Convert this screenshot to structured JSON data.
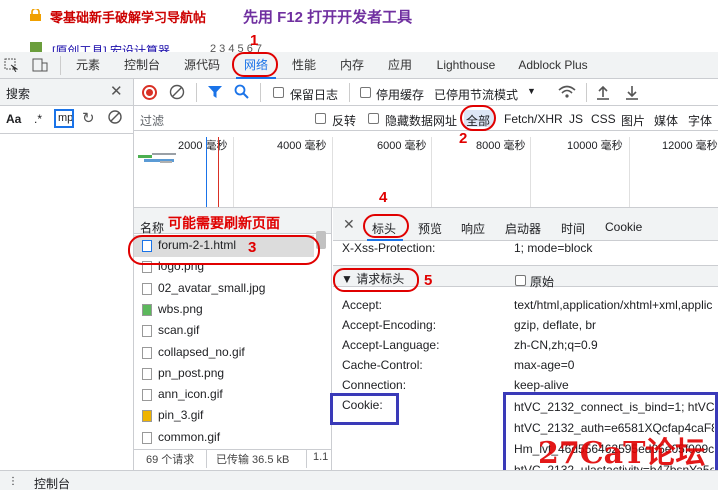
{
  "page": {
    "title": "零基础新手破解学习导航帖",
    "annotation_f12": "先用 F12 打开开发者工具",
    "link_text": "[原创工具] 宏设计算器",
    "link_suffix": "2 3 4 5 6 7"
  },
  "tabs": [
    "元素",
    "控制台",
    "源代码",
    "网络",
    "性能",
    "内存",
    "应用",
    "Lighthouse",
    "Adblock Plus"
  ],
  "search": {
    "title": "搜索",
    "aa": "Aa",
    "regex": ".*",
    "value": "mp"
  },
  "network_toolbar": {
    "preserve_log": "保留日志",
    "disable_cache": "停用缓存",
    "throttle": "已停用节流模式"
  },
  "filter": {
    "placeholder": "过滤",
    "invert": "反转",
    "hide_data_urls": "隐藏数据网址",
    "types": [
      "全部",
      "Fetch/XHR",
      "JS",
      "CSS",
      "图片",
      "媒体",
      "字体"
    ]
  },
  "timeline": {
    "ticks": [
      "2000 毫秒",
      "4000 毫秒",
      "6000 毫秒",
      "8000 毫秒",
      "10000 毫秒",
      "12000 毫秒"
    ]
  },
  "list": {
    "header": "名称",
    "note": "可能需要刷新页面",
    "items": [
      "forum-2-1.html",
      "logo.png",
      "02_avatar_small.jpg",
      "wbs.png",
      "scan.gif",
      "collapsed_no.gif",
      "pn_post.png",
      "ann_icon.gif",
      "pin_3.gif",
      "common.gif"
    ],
    "status_requests": "69 个请求",
    "status_transferred": "已传输 36.5 kB",
    "status_more": "1.1"
  },
  "details": {
    "tabs": [
      "标头",
      "预览",
      "响应",
      "启动器",
      "时间",
      "Cookie"
    ],
    "xss_label": "X-Xss-Protection:",
    "xss_value": "1; mode=block",
    "section": "▼ 请求标头",
    "raw": "原始",
    "headers": [
      {
        "k": "Accept:",
        "v": "text/html,application/xhtml+xml,applic"
      },
      {
        "k": "Accept-Encoding:",
        "v": "gzip, deflate, br"
      },
      {
        "k": "Accept-Language:",
        "v": "zh-CN,zh;q=0.9"
      },
      {
        "k": "Cache-Control:",
        "v": "max-age=0"
      },
      {
        "k": "Connection:",
        "v": "keep-alive"
      },
      {
        "k": "Cookie:",
        "v": ""
      }
    ],
    "cookie_lines": [
      "htVC_2132_connect_is_bind=1; htVC_2",
      "htVC_2132_auth=e6581XQcfap4caF8D",
      "Hm_lvt_46d556462595ed05e05f009cdafa",
      "htVC_2132_ulastactivity=b47bsnYa5e"
    ]
  },
  "annotations": {
    "n1": "1",
    "n2": "2",
    "n3": "3",
    "n4": "4",
    "n5": "5"
  },
  "watermark": "27CaT论坛",
  "bottom": {
    "drawer_tab": "控制台"
  }
}
